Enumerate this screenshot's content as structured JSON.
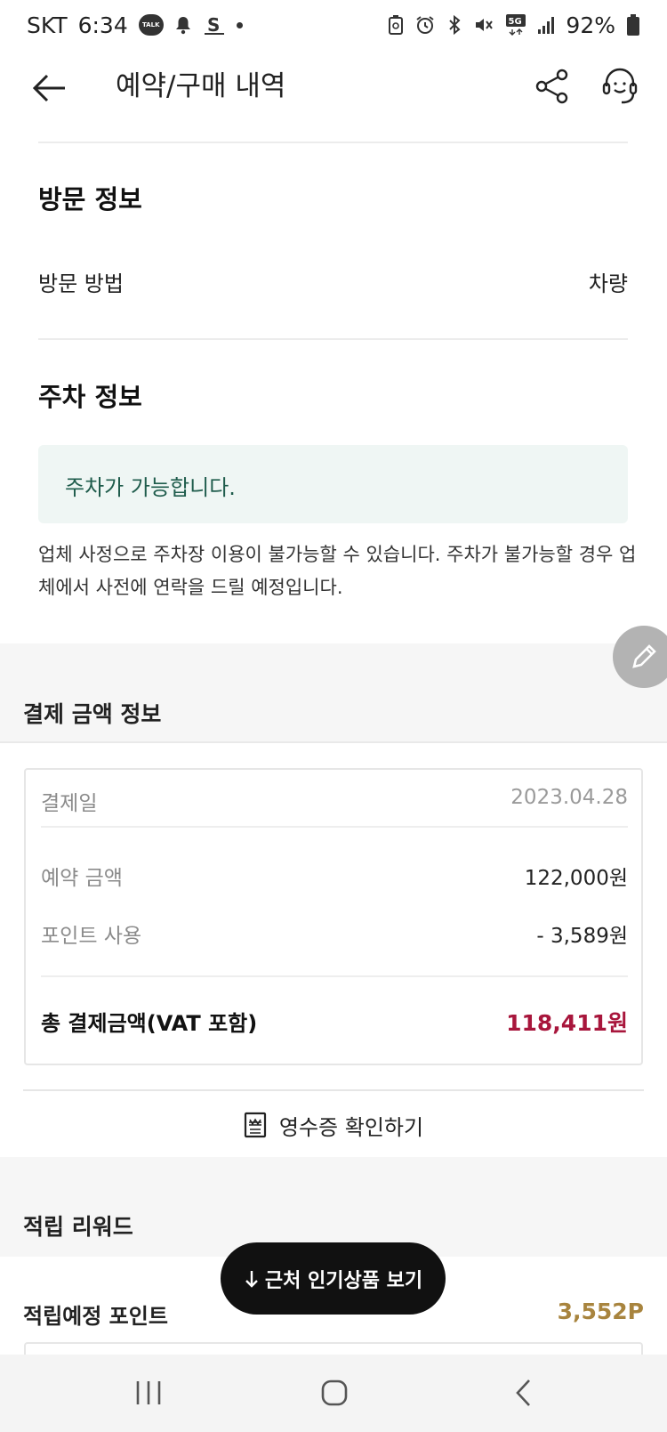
{
  "status_bar": {
    "carrier": "SKT",
    "time": "6:34",
    "talk_badge": "TALK",
    "battery": "92%",
    "network": "5G",
    "icons": [
      "kakaotalk-icon",
      "bell-icon",
      "s-app-icon",
      "dot-icon",
      "recycle-battery-icon",
      "alarm-icon",
      "bluetooth-icon",
      "mute-icon",
      "5g-icon",
      "signal-icon",
      "battery-icon"
    ]
  },
  "app_bar": {
    "title": "예약/구매 내역",
    "icons": [
      "arrow-left-icon",
      "share-icon",
      "headset-icon"
    ]
  },
  "visit_info": {
    "title": "방문 정보",
    "method_label": "방문 방법",
    "method_value": "차량"
  },
  "parking_info": {
    "title": "주차 정보",
    "status": "주차가 가능합니다.",
    "note": "업체 사정으로 주차장 이용이 불가능할 수 있습니다. 주차가 불가능할 경우 업체에서 사전에 연락을 드릴 예정입니다."
  },
  "payment": {
    "title": "결제 금액 정보",
    "date_label": "결제일",
    "date_value": "2023.04.28",
    "reserve_label": "예약 금액",
    "reserve_value": "122,000원",
    "point_label": "포인트 사용",
    "point_value": "- 3,589원",
    "total_label": "총 결제금액(VAT 포함)",
    "total_value": "118,411원",
    "receipt_label": "영수증 확인하기"
  },
  "reward": {
    "title": "적립 리워드",
    "points_label": "적립예정 포인트",
    "points_value": "3,552P"
  },
  "floating": {
    "nearby_label": "근처 인기상품 보기"
  },
  "colors": {
    "accent_total": "#a8163c",
    "reward_gold": "#a8843e",
    "parking_bg": "#eff6f4",
    "parking_text": "#1f5c4c"
  }
}
